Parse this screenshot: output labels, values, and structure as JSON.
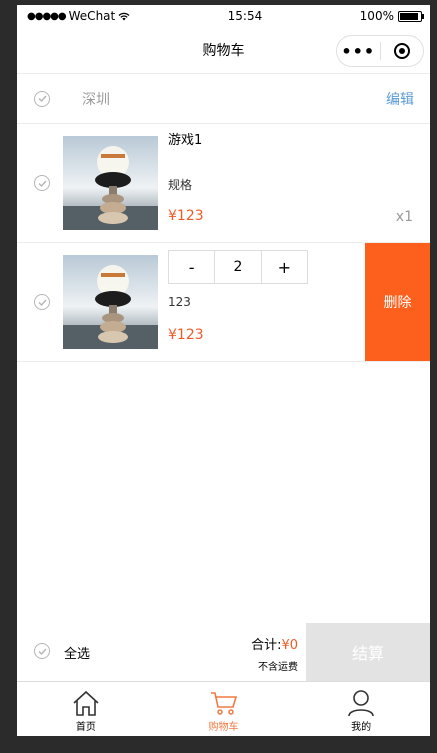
{
  "status": {
    "carrier": "WeChat",
    "time": "15:54",
    "battery": "100%"
  },
  "nav": {
    "title": "购物车"
  },
  "shop": {
    "name": "深圳",
    "edit_label": "编辑"
  },
  "items": [
    {
      "name": "游戏1",
      "spec": "规格",
      "price": "¥123",
      "qty": "x1"
    },
    {
      "spec": "123",
      "price": "¥123",
      "stepper": {
        "minus": "-",
        "value": "2",
        "plus": "+"
      },
      "delete_label": "删除"
    }
  ],
  "footer": {
    "select_all": "全选",
    "total_label": "合计:",
    "total_amount": "¥0",
    "shipping_note": "不含运费",
    "checkout_label": "结算"
  },
  "tabs": [
    {
      "label": "首页",
      "icon": "home-icon"
    },
    {
      "label": "购物车",
      "icon": "cart-icon",
      "active": true
    },
    {
      "label": "我的",
      "icon": "user-icon"
    }
  ],
  "colors": {
    "accent": "#f05a28",
    "delete": "#fd5f1d",
    "edit": "#5b9bd5",
    "checkout_bg": "#e3e3e3"
  }
}
